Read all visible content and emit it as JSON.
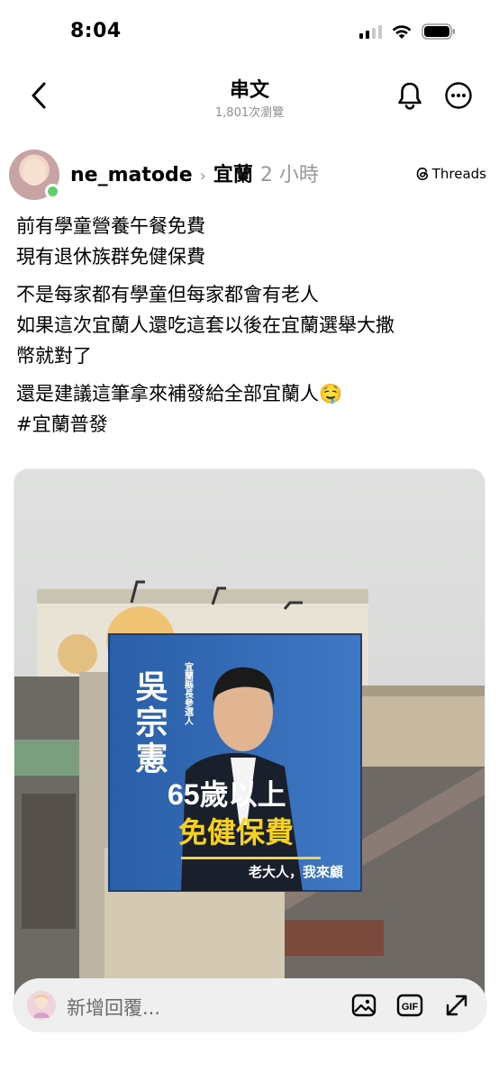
{
  "status_bar": {
    "time": "8:04"
  },
  "nav": {
    "title": "串文",
    "views": "1,801次瀏覽"
  },
  "post": {
    "username": "ne_matode",
    "topic": "宜蘭",
    "time_ago": "2 小時",
    "source_badge": "Threads",
    "paragraphs": [
      [
        "前有學童營養午餐免費",
        "現有退休族群免健保費"
      ],
      [
        "不是每家都有學童但每家都會有老人",
        "如果這次宜蘭人還吃這套以後在宜蘭選舉大撒",
        "幣就對了"
      ],
      [
        "還是建議這筆拿來補發給全部宜蘭人🤤",
        "#宜蘭普發"
      ]
    ]
  },
  "billboard": {
    "candidate_name": "吳宗憲",
    "candidate_role": "宜蘭縣長參選人",
    "headline_1": "65歲以上",
    "headline_2": "免健保費",
    "slogan": "老大人，我來顧"
  },
  "reply": {
    "placeholder": "新增回覆..."
  },
  "icons": [
    "back-icon",
    "bell-icon",
    "more-icon",
    "threads-icon",
    "image-icon",
    "gif-icon",
    "expand-icon"
  ]
}
